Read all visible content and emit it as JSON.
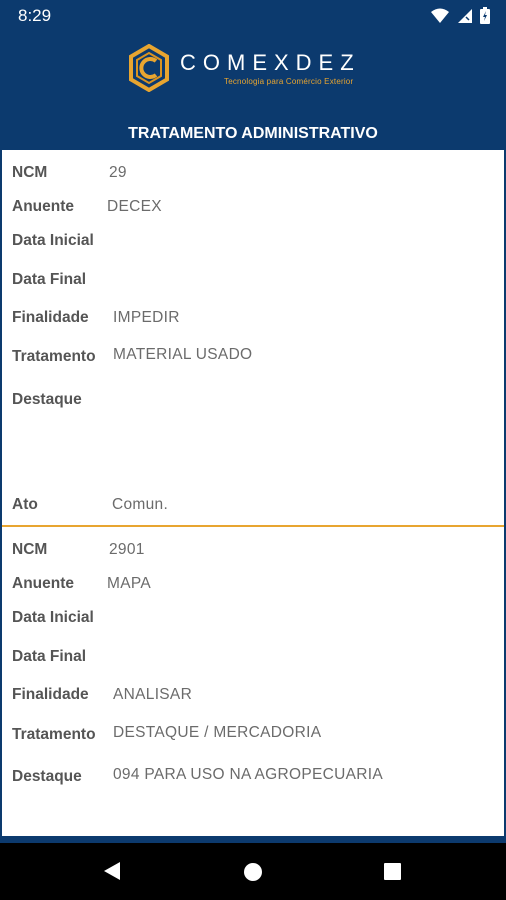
{
  "status_bar": {
    "time": "8:29"
  },
  "brand": {
    "name": "COMEXDEZ",
    "tagline": "Tecnologia para Comércio Exterior",
    "accent_color": "#e8a530",
    "primary_color": "#0c3a6e"
  },
  "page_title": "TRATAMENTO ADMINISTRATIVO",
  "records": [
    {
      "ncm_label": "NCM",
      "ncm": "29",
      "anuente_label": "Anuente",
      "anuente": "DECEX",
      "data_inicial_label": "Data Inicial",
      "data_inicial": "",
      "data_final_label": "Data Final",
      "data_final": "",
      "finalidade_label": "Finalidade",
      "finalidade": "IMPEDIR",
      "tratamento_label": "Tratamento",
      "tratamento": "MATERIAL USADO",
      "destaque_label": "Destaque",
      "destaque": "",
      "ato_label": "Ato",
      "ato": "Comun."
    },
    {
      "ncm_label": "NCM",
      "ncm": "2901",
      "anuente_label": "Anuente",
      "anuente": "MAPA",
      "data_inicial_label": "Data Inicial",
      "data_inicial": "",
      "data_final_label": "Data Final",
      "data_final": "",
      "finalidade_label": "Finalidade",
      "finalidade": "ANALISAR",
      "tratamento_label": "Tratamento",
      "tratamento": "DESTAQUE / MERCADORIA",
      "destaque_label": "Destaque",
      "destaque": "094 PARA USO NA AGROPECUARIA"
    }
  ],
  "icons": {
    "wifi": "wifi-icon",
    "signal": "signal-icon",
    "battery": "battery-icon",
    "back": "back-icon",
    "home": "home-icon",
    "recents": "recents-icon"
  }
}
